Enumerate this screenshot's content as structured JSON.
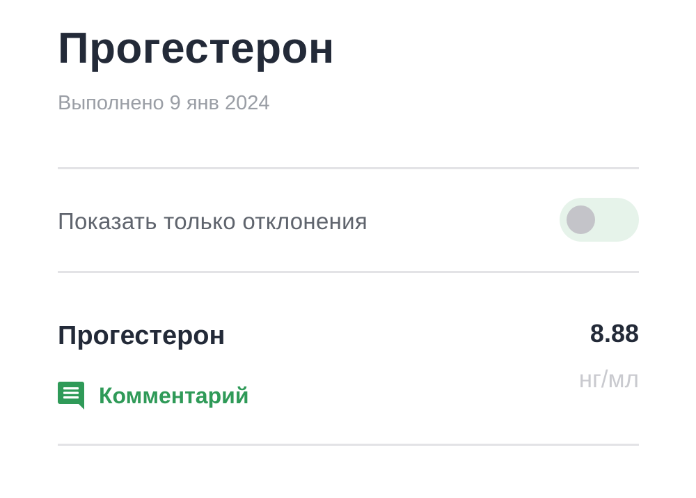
{
  "header": {
    "title": "Прогестерон",
    "subtitle": "Выполнено 9 янв 2024"
  },
  "filter": {
    "label": "Показать только отклонения",
    "enabled": false
  },
  "results": [
    {
      "name": "Прогестерон",
      "value": "8.88",
      "unit": "нг/мл",
      "comment_label": "Комментарий"
    }
  ],
  "colors": {
    "accent": "#2f9a58",
    "toggle_track": "#e6f3ea",
    "toggle_knob": "#c4c4c9",
    "primary_text": "#232a38",
    "secondary_text": "#9a9ea5",
    "divider": "#e3e3e6"
  },
  "icons": {
    "comment": "comment-icon"
  }
}
